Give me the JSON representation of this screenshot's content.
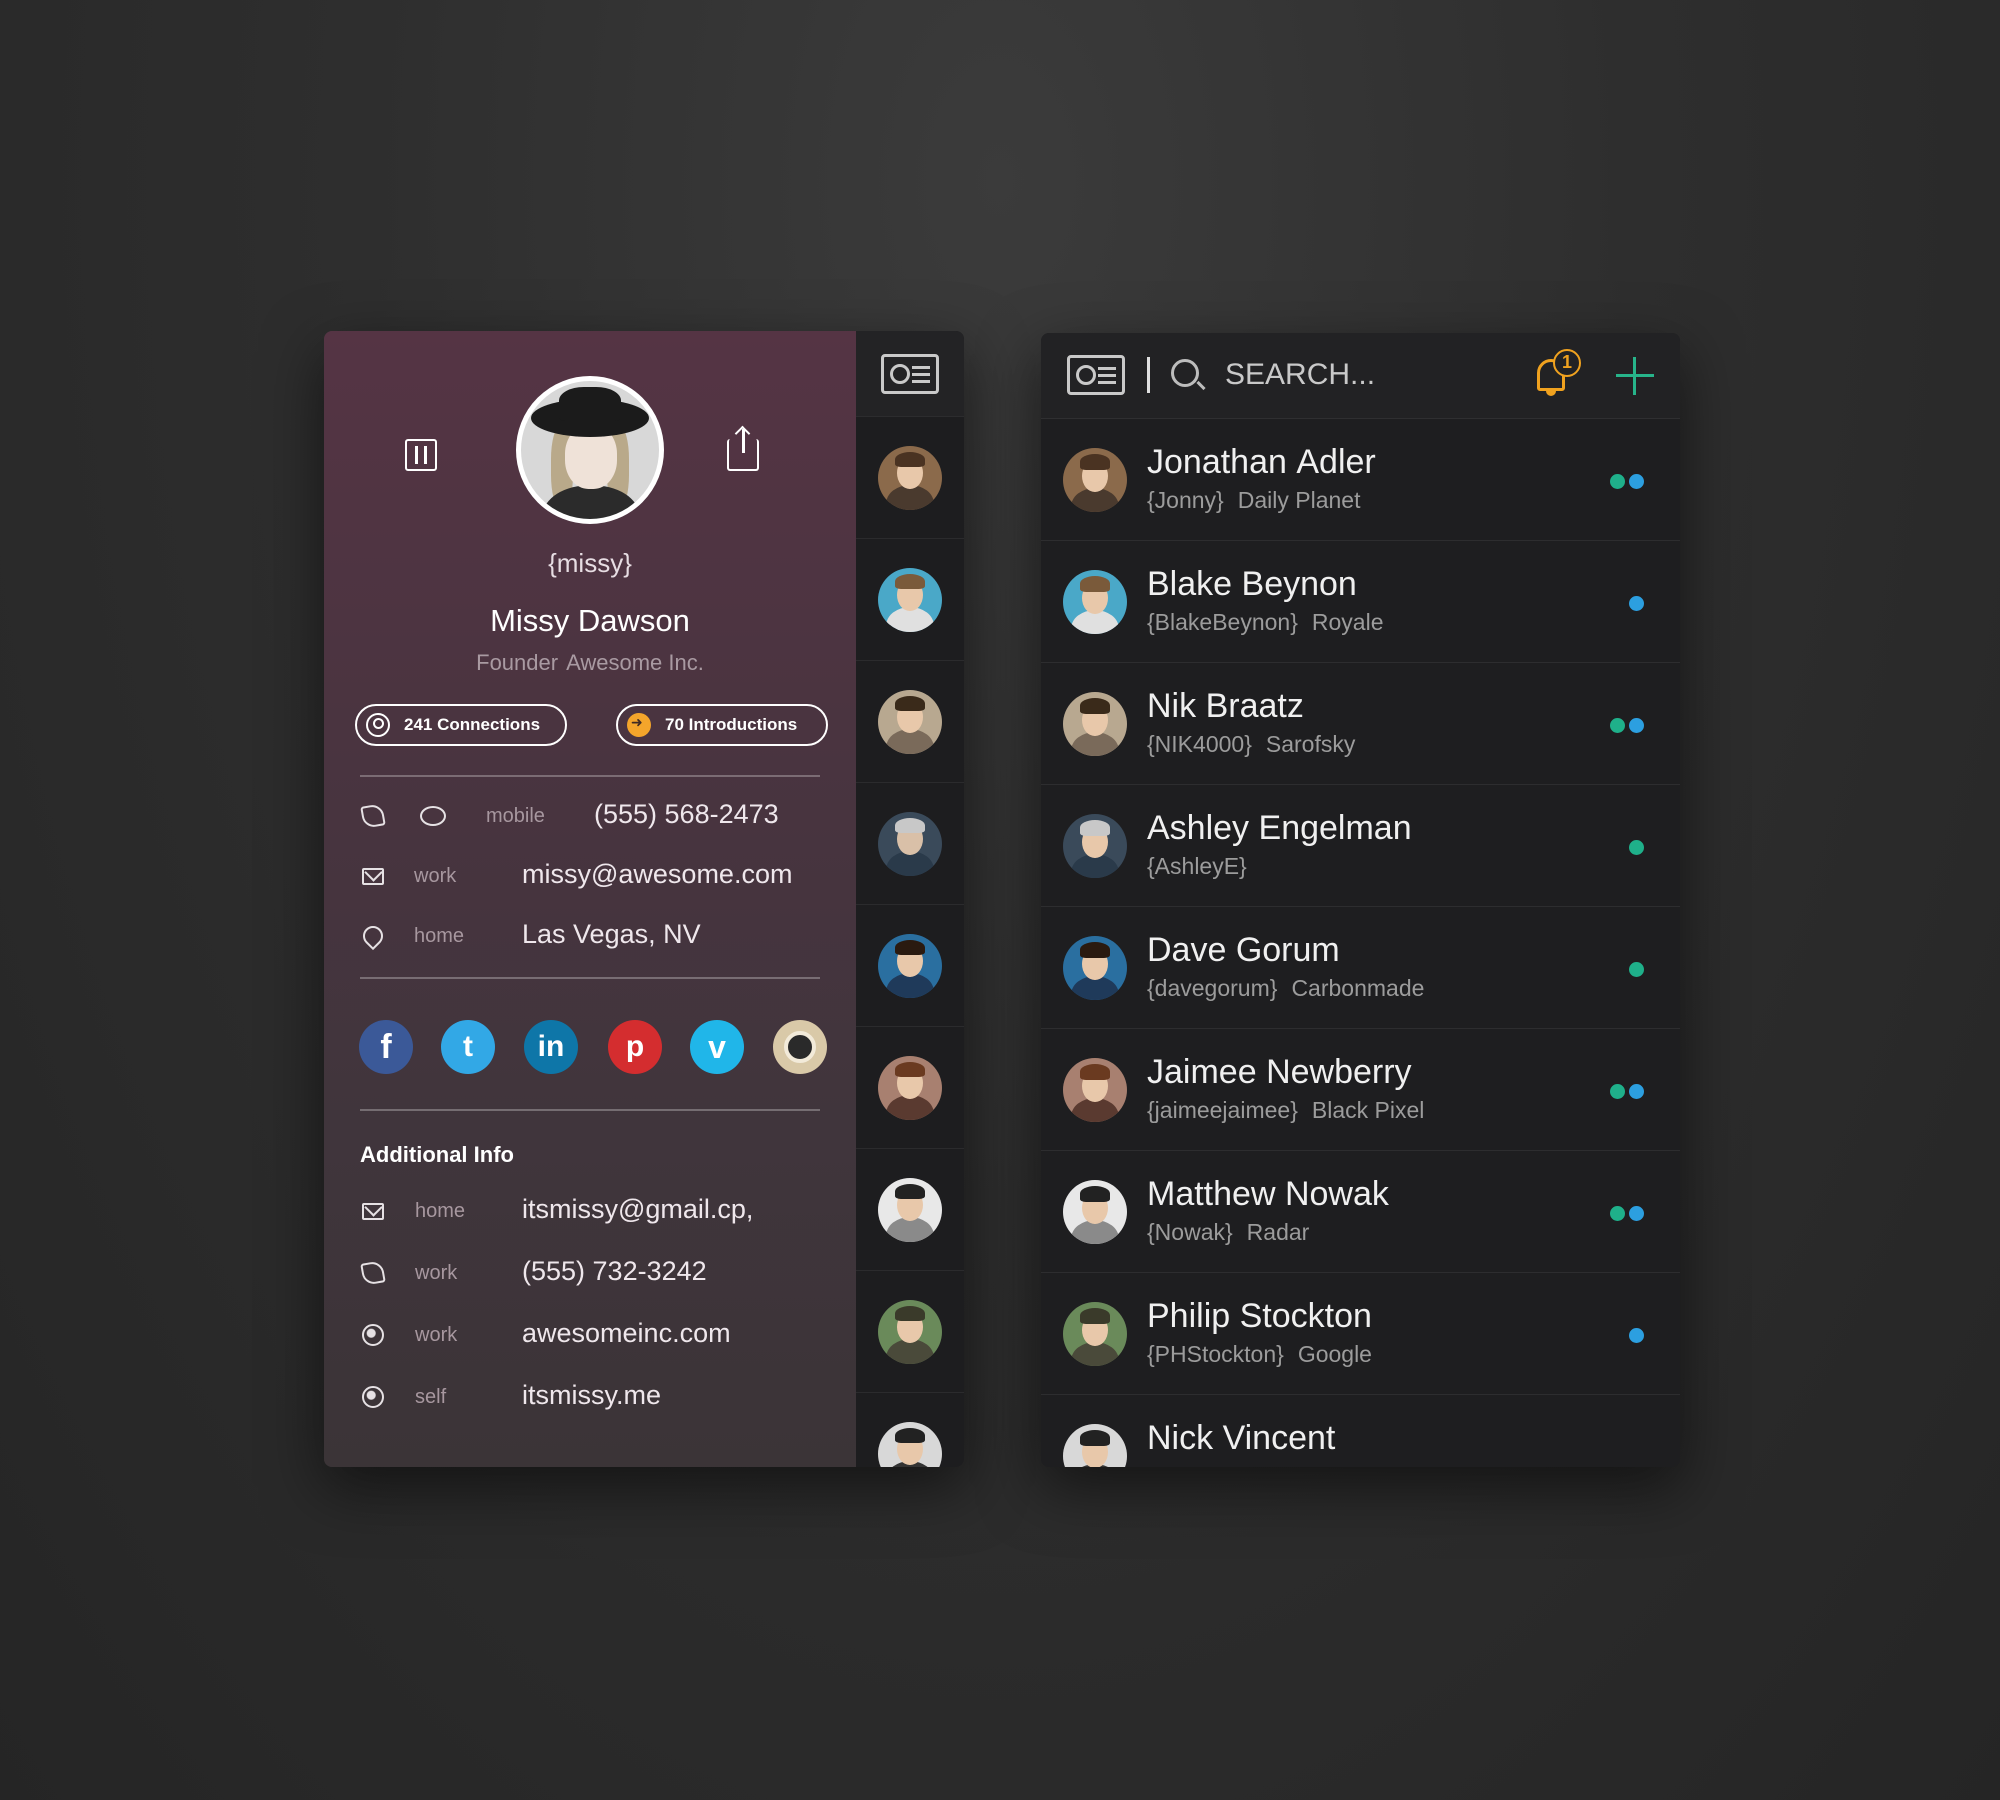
{
  "profile": {
    "handle": "{missy}",
    "name": "Missy Dawson",
    "title": "Founder",
    "company": "Awesome Inc.",
    "connections_label": "241 Connections",
    "introductions_label": "70 Introductions",
    "contacts": [
      {
        "label": "mobile",
        "value": "(555) 568-2473"
      },
      {
        "label": "work",
        "value": "missy@awesome.com"
      },
      {
        "label": "home",
        "value": "Las Vegas, NV"
      }
    ],
    "social": [
      {
        "name": "facebook",
        "glyph": "f",
        "color": "#3b5998"
      },
      {
        "name": "twitter",
        "glyph": "t",
        "color": "#32a8e6"
      },
      {
        "name": "linkedin",
        "glyph": "in",
        "color": "#0e76a8"
      },
      {
        "name": "pinterest",
        "glyph": "p",
        "color": "#d42d2f"
      },
      {
        "name": "vimeo",
        "glyph": "v",
        "color": "#20b6e9"
      },
      {
        "name": "instagram",
        "glyph": "",
        "color": "#d9c9a8"
      }
    ],
    "additional_title": "Additional Info",
    "additional": [
      {
        "label": "home",
        "value": "itsmissy@gmail.cp,"
      },
      {
        "label": "work",
        "value": "(555) 732-3242"
      },
      {
        "label": "work",
        "value": "awesomeinc.com"
      },
      {
        "label": "self",
        "value": "itsmissy.me"
      }
    ]
  },
  "search": {
    "placeholder": "SEARCH...",
    "notifications": "1"
  },
  "contacts_list": [
    {
      "first": "Jonathan",
      "last": "Adler",
      "handle": "{Jonny}",
      "company": "Daily Planet",
      "status": [
        "green",
        "blue"
      ]
    },
    {
      "first": "Blake",
      "last": "Beynon",
      "handle": "{BlakeBeynon}",
      "company": "Royale",
      "status": [
        "blue"
      ]
    },
    {
      "first": "Nik",
      "last": "Braatz",
      "handle": "{NIK4000}",
      "company": "Sarofsky",
      "status": [
        "green",
        "blue"
      ]
    },
    {
      "first": "Ashley",
      "last": "Engelman",
      "handle": "{AshleyE}",
      "company": "",
      "status": [
        "green"
      ]
    },
    {
      "first": "Dave",
      "last": "Gorum",
      "handle": "{davegorum}",
      "company": "Carbonmade",
      "status": [
        "green"
      ]
    },
    {
      "first": "Jaimee",
      "last": "Newberry",
      "handle": "{jaimeejaimee}",
      "company": "Black Pixel",
      "status": [
        "green",
        "blue"
      ]
    },
    {
      "first": "Matthew",
      "last": "Nowak",
      "handle": "{Nowak}",
      "company": "Radar",
      "status": [
        "green",
        "blue"
      ]
    },
    {
      "first": "Philip",
      "last": "Stockton",
      "handle": "{PHStockton}",
      "company": "Google",
      "status": [
        "blue"
      ]
    },
    {
      "first": "Nick",
      "last": "Vincent",
      "handle": "",
      "company": "",
      "status": []
    }
  ],
  "colors": {
    "accent_green": "#1fb08a",
    "accent_blue": "#2c9fe0",
    "notification_orange": "#f0a21f"
  }
}
